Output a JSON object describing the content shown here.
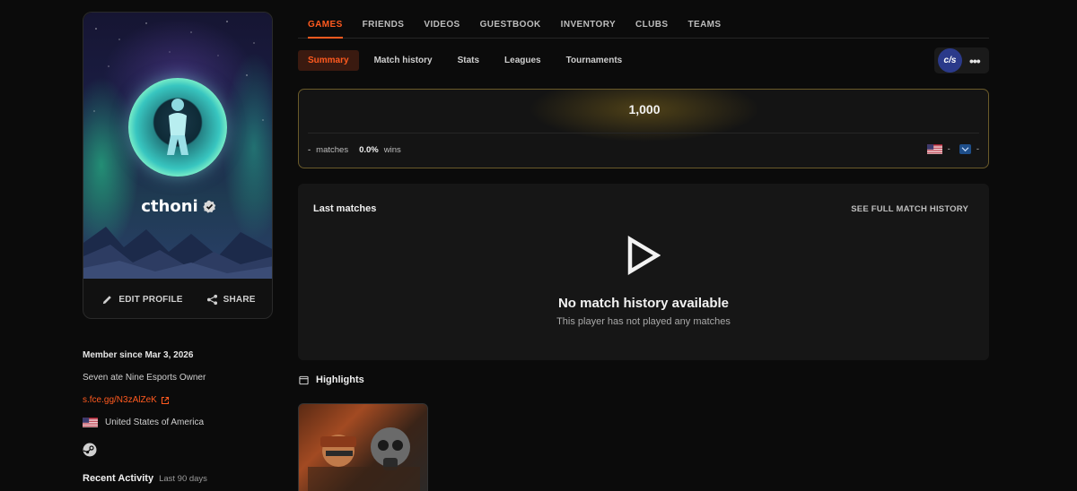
{
  "profile": {
    "username": "cthoni",
    "edit_label": "EDIT PROFILE",
    "share_label": "SHARE"
  },
  "about": {
    "member_since": "Member since Mar 3, 2026",
    "bio": "Seven ate Nine Esports Owner",
    "link": "s.fce.gg/N3zAlZeK",
    "country": "United States of America",
    "recent_activity_title": "Recent Activity",
    "recent_activity_period": "Last 90 days"
  },
  "top_tabs": [
    {
      "label": "GAMES",
      "active": true
    },
    {
      "label": "FRIENDS",
      "active": false
    },
    {
      "label": "VIDEOS",
      "active": false
    },
    {
      "label": "GUESTBOOK",
      "active": false
    },
    {
      "label": "INVENTORY",
      "active": false
    },
    {
      "label": "CLUBS",
      "active": false
    },
    {
      "label": "TEAMS",
      "active": false
    }
  ],
  "sub_tabs": [
    {
      "label": "Summary",
      "active": true
    },
    {
      "label": "Match history",
      "active": false
    },
    {
      "label": "Stats",
      "active": false
    },
    {
      "label": "Leagues",
      "active": false
    },
    {
      "label": "Tournaments",
      "active": false
    }
  ],
  "game_switch": {
    "logo_text": "c/s",
    "more": "•••"
  },
  "elo": {
    "value": "1,000",
    "matches_value": "-",
    "matches_label": "matches",
    "winrate_value": "0.0%",
    "winrate_label": "wins",
    "country_rank": "-",
    "region_rank": "-"
  },
  "last_matches": {
    "title": "Last matches",
    "link": "SEE FULL MATCH HISTORY",
    "empty_title": "No match history available",
    "empty_subtitle": "This player has not played any matches"
  },
  "highlights": {
    "title": "Highlights"
  },
  "colors": {
    "accent": "#ff5a1f",
    "elo_border": "#6a5a2a",
    "background": "#0b0b0b"
  }
}
